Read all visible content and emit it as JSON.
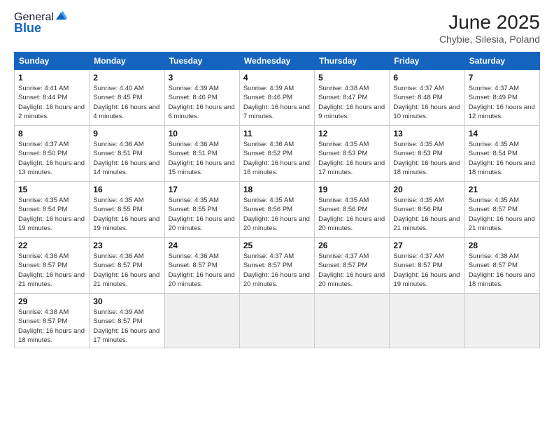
{
  "header": {
    "logo_general": "General",
    "logo_blue": "Blue",
    "title": "June 2025",
    "subtitle": "Chybie, Silesia, Poland"
  },
  "days_of_week": [
    "Sunday",
    "Monday",
    "Tuesday",
    "Wednesday",
    "Thursday",
    "Friday",
    "Saturday"
  ],
  "weeks": [
    [
      {
        "day": 1,
        "sunrise": "4:41 AM",
        "sunset": "8:44 PM",
        "daylight": "16 hours and 2 minutes."
      },
      {
        "day": 2,
        "sunrise": "4:40 AM",
        "sunset": "8:45 PM",
        "daylight": "16 hours and 4 minutes."
      },
      {
        "day": 3,
        "sunrise": "4:39 AM",
        "sunset": "8:46 PM",
        "daylight": "16 hours and 6 minutes."
      },
      {
        "day": 4,
        "sunrise": "4:39 AM",
        "sunset": "8:46 PM",
        "daylight": "16 hours and 7 minutes."
      },
      {
        "day": 5,
        "sunrise": "4:38 AM",
        "sunset": "8:47 PM",
        "daylight": "16 hours and 9 minutes."
      },
      {
        "day": 6,
        "sunrise": "4:37 AM",
        "sunset": "8:48 PM",
        "daylight": "16 hours and 10 minutes."
      },
      {
        "day": 7,
        "sunrise": "4:37 AM",
        "sunset": "8:49 PM",
        "daylight": "16 hours and 12 minutes."
      }
    ],
    [
      {
        "day": 8,
        "sunrise": "4:37 AM",
        "sunset": "8:50 PM",
        "daylight": "16 hours and 13 minutes."
      },
      {
        "day": 9,
        "sunrise": "4:36 AM",
        "sunset": "8:51 PM",
        "daylight": "16 hours and 14 minutes."
      },
      {
        "day": 10,
        "sunrise": "4:36 AM",
        "sunset": "8:51 PM",
        "daylight": "16 hours and 15 minutes."
      },
      {
        "day": 11,
        "sunrise": "4:36 AM",
        "sunset": "8:52 PM",
        "daylight": "16 hours and 16 minutes."
      },
      {
        "day": 12,
        "sunrise": "4:35 AM",
        "sunset": "8:53 PM",
        "daylight": "16 hours and 17 minutes."
      },
      {
        "day": 13,
        "sunrise": "4:35 AM",
        "sunset": "8:53 PM",
        "daylight": "16 hours and 18 minutes."
      },
      {
        "day": 14,
        "sunrise": "4:35 AM",
        "sunset": "8:54 PM",
        "daylight": "16 hours and 18 minutes."
      }
    ],
    [
      {
        "day": 15,
        "sunrise": "4:35 AM",
        "sunset": "8:54 PM",
        "daylight": "16 hours and 19 minutes."
      },
      {
        "day": 16,
        "sunrise": "4:35 AM",
        "sunset": "8:55 PM",
        "daylight": "16 hours and 19 minutes."
      },
      {
        "day": 17,
        "sunrise": "4:35 AM",
        "sunset": "8:55 PM",
        "daylight": "16 hours and 20 minutes."
      },
      {
        "day": 18,
        "sunrise": "4:35 AM",
        "sunset": "8:56 PM",
        "daylight": "16 hours and 20 minutes."
      },
      {
        "day": 19,
        "sunrise": "4:35 AM",
        "sunset": "8:56 PM",
        "daylight": "16 hours and 20 minutes."
      },
      {
        "day": 20,
        "sunrise": "4:35 AM",
        "sunset": "8:56 PM",
        "daylight": "16 hours and 21 minutes."
      },
      {
        "day": 21,
        "sunrise": "4:35 AM",
        "sunset": "8:57 PM",
        "daylight": "16 hours and 21 minutes."
      }
    ],
    [
      {
        "day": 22,
        "sunrise": "4:36 AM",
        "sunset": "8:57 PM",
        "daylight": "16 hours and 21 minutes."
      },
      {
        "day": 23,
        "sunrise": "4:36 AM",
        "sunset": "8:57 PM",
        "daylight": "16 hours and 21 minutes."
      },
      {
        "day": 24,
        "sunrise": "4:36 AM",
        "sunset": "8:57 PM",
        "daylight": "16 hours and 20 minutes."
      },
      {
        "day": 25,
        "sunrise": "4:37 AM",
        "sunset": "8:57 PM",
        "daylight": "16 hours and 20 minutes."
      },
      {
        "day": 26,
        "sunrise": "4:37 AM",
        "sunset": "8:57 PM",
        "daylight": "16 hours and 20 minutes."
      },
      {
        "day": 27,
        "sunrise": "4:37 AM",
        "sunset": "8:57 PM",
        "daylight": "16 hours and 19 minutes."
      },
      {
        "day": 28,
        "sunrise": "4:38 AM",
        "sunset": "8:57 PM",
        "daylight": "16 hours and 18 minutes."
      }
    ],
    [
      {
        "day": 29,
        "sunrise": "4:38 AM",
        "sunset": "8:57 PM",
        "daylight": "16 hours and 18 minutes."
      },
      {
        "day": 30,
        "sunrise": "4:39 AM",
        "sunset": "8:57 PM",
        "daylight": "16 hours and 17 minutes."
      },
      null,
      null,
      null,
      null,
      null
    ]
  ]
}
